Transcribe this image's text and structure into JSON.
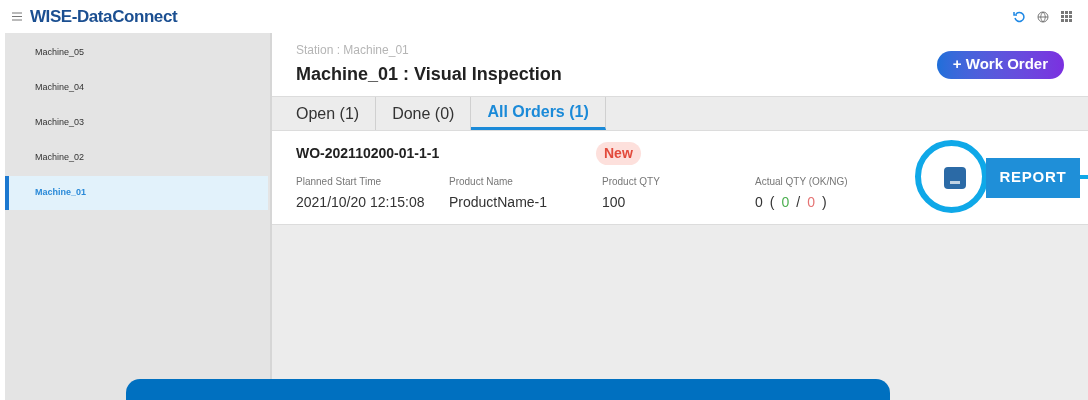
{
  "app": {
    "title": "WISE-DataConnect"
  },
  "sidebar": {
    "items": [
      {
        "label": "Machine_05",
        "selected": false
      },
      {
        "label": "Machine_04",
        "selected": false
      },
      {
        "label": "Machine_03",
        "selected": false
      },
      {
        "label": "Machine_02",
        "selected": false
      },
      {
        "label": "Machine_01",
        "selected": true
      }
    ]
  },
  "header": {
    "station": "Station : Machine_01",
    "title": "Machine_01 : Visual Inspection",
    "button": "+ Work Order"
  },
  "tabs": [
    {
      "label": "Open",
      "count": "(1)",
      "selected": false
    },
    {
      "label": "Done",
      "count": "(0)",
      "selected": false
    },
    {
      "label": "All Orders",
      "count": "(1)",
      "selected": true
    }
  ],
  "order": {
    "id": "WO-202110200-01-1-1",
    "status": "New",
    "fields": [
      {
        "label": "Planned Start Time",
        "value": "2021/10/20 12:15:08"
      },
      {
        "label": "Product Name",
        "value": "ProductName-1"
      },
      {
        "label": "Product QTY",
        "value": "100"
      }
    ],
    "actual": {
      "label": "Actual QTY (OK/NG)",
      "total": "0",
      "open": "(",
      "ok": "0",
      "sep": "/",
      "ng": "0",
      "close": ")"
    },
    "report_button": "REPORT"
  }
}
